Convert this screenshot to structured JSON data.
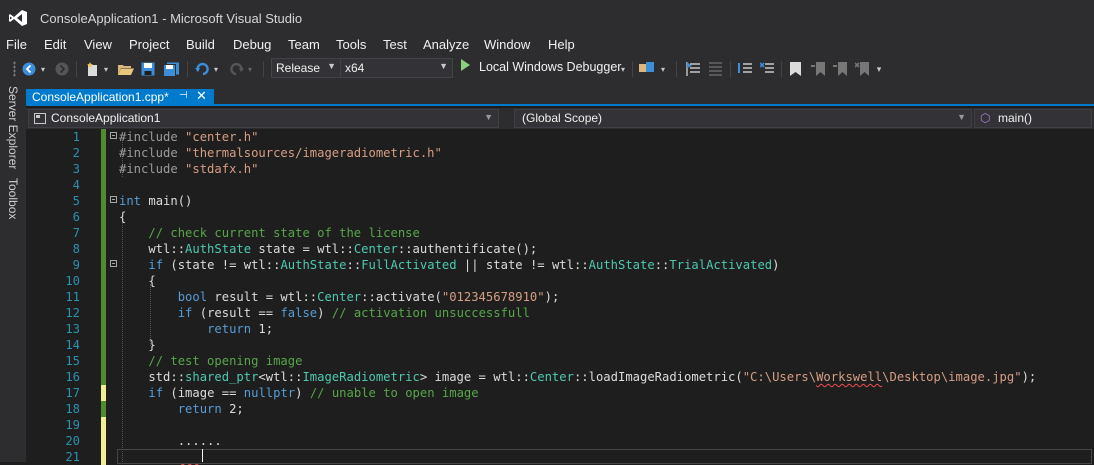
{
  "window": {
    "title": "ConsoleApplication1 - Microsoft Visual Studio"
  },
  "menu": [
    "File",
    "Edit",
    "View",
    "Project",
    "Build",
    "Debug",
    "Team",
    "Tools",
    "Test",
    "Analyze",
    "Window",
    "Help"
  ],
  "toolbar": {
    "configuration": "Release",
    "platform": "x64",
    "run_label": "Local Windows Debugger"
  },
  "sidebar": {
    "server_explorer": "Server Explorer",
    "toolbox": "Toolbox"
  },
  "tab": {
    "label": "ConsoleApplication1.cpp*"
  },
  "navbar": {
    "project": "ConsoleApplication1",
    "scope": "(Global Scope)",
    "member": "main()"
  },
  "code_lines": [
    "#include \"center.h\"",
    "#include \"thermalsources/imageradiometric.h\"",
    "#include \"stdafx.h\"",
    "",
    "int main()",
    "{",
    "    // check current state of the license",
    "    wtl::AuthState state = wtl::Center::authentificate();",
    "    if (state != wtl::AuthState::FullActivated || state != wtl::AuthState::TrialActivated)",
    "    {",
    "        bool result = wtl::Center::activate(\"012345678910\");",
    "        if (result == false) // activation unsuccessfull",
    "            return 1;",
    "    }",
    "    // test opening image",
    "    std::shared_ptr<wtl::ImageRadiometric> image = wtl::Center::loadImageRadiometric(\"C:\\Users\\Workswell\\Desktop\\image.jpg\");",
    "    if (image == nullptr) // unable to open image",
    "        return 2;",
    "",
    "        ......",
    ""
  ],
  "line_numbers": [
    "1",
    "2",
    "3",
    "4",
    "5",
    "6",
    "7",
    "8",
    "9",
    "10",
    "11",
    "12",
    "13",
    "14",
    "15",
    "16",
    "17",
    "18",
    "19",
    "20",
    "21"
  ],
  "colors": {
    "accent": "#007acc",
    "keyword": "#569cd6",
    "string": "#d69d85",
    "comment": "#57a64a",
    "type": "#4ec9b0",
    "line_number": "#2b91af",
    "saved_change": "#4e8c2f",
    "unsaved_change": "#efef91"
  }
}
